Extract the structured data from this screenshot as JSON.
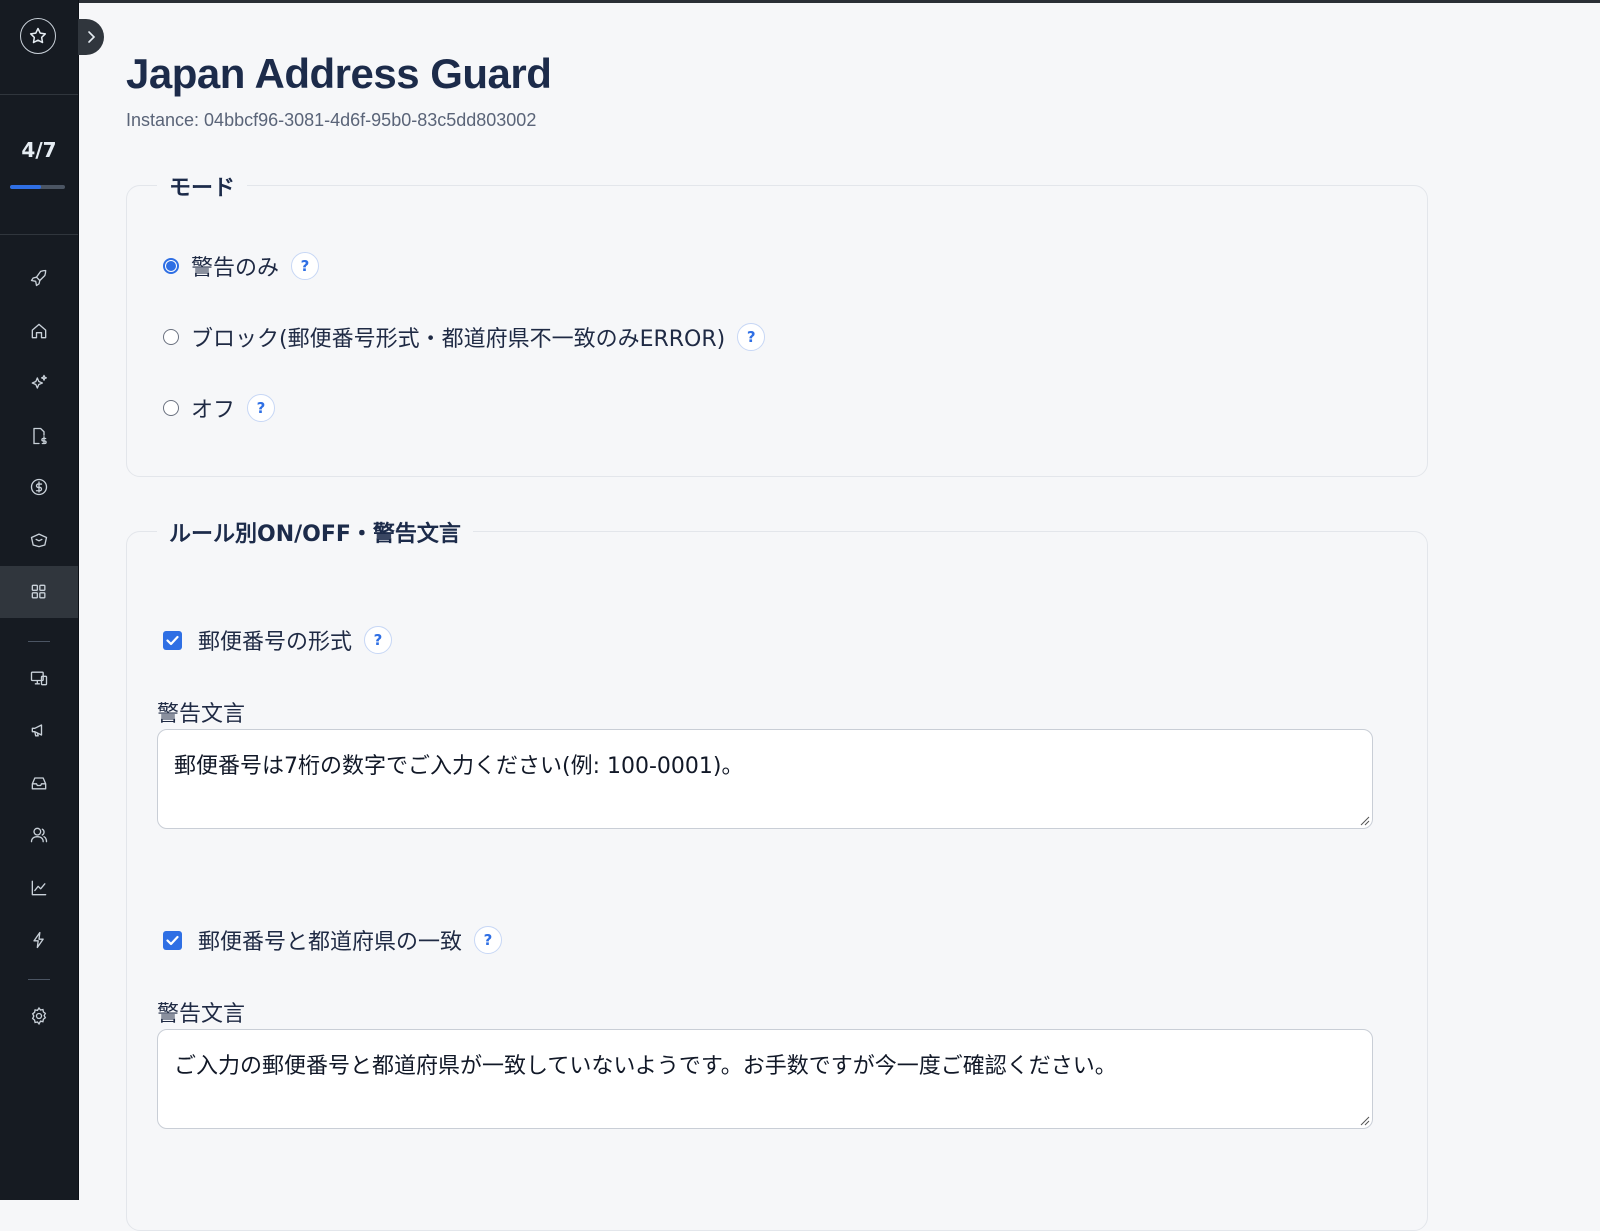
{
  "header": {
    "title": "Japan Address Guard",
    "instance": "Instance: 04bbcf96-3081-4d6f-95b0-83c5dd803002"
  },
  "sidebar": {
    "progress_label": "4/7",
    "progress_fraction": 0.57,
    "nav_icons": [
      "rocket-icon",
      "home-icon",
      "sparkles-icon",
      "invoice-dollar-icon",
      "dollar-circle-icon",
      "tickets-icon",
      "apps-icon",
      "devices-icon",
      "megaphone-icon",
      "inbox-icon",
      "users-icon",
      "chart-line-icon",
      "bolt-icon",
      "gear-icon"
    ],
    "active_icon": "apps-icon",
    "accent": "#2f6fe4"
  },
  "mode": {
    "legend": "モード",
    "options": [
      {
        "label": "警告のみ",
        "checked": true
      },
      {
        "label": "ブロック(郵便番号形式・都道府県不一致のみERROR)",
        "checked": false
      },
      {
        "label": "オフ",
        "checked": false
      }
    ]
  },
  "rules": {
    "legend": "ルール別ON/OFF・警告文言",
    "items": [
      {
        "label": "郵便番号の形式",
        "checked": true,
        "message_label": "警告文言",
        "message": "郵便番号は7桁の数字でご入力ください(例: 100-0001)。"
      },
      {
        "label": "郵便番号と都道府県の一致",
        "checked": true,
        "message_label": "警告文言",
        "message": "ご入力の郵便番号と都道府県が一致していないようです。お手数ですが今一度ご確認ください。"
      }
    ]
  },
  "help_symbol": "?"
}
